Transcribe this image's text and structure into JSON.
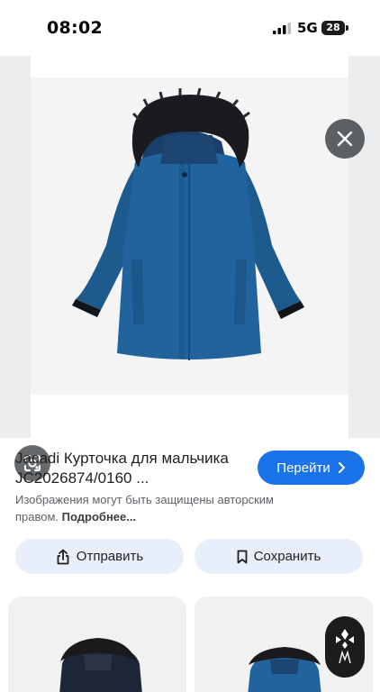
{
  "status_bar": {
    "time": "08:02",
    "network": "5G",
    "battery": "28"
  },
  "viewer": {
    "close_icon": "close-icon",
    "lens_icon": "google-lens-icon"
  },
  "result": {
    "title": "Jacadi Курточка для мальчика JC2026874/0160 ...",
    "visit_label": "Перейти",
    "visit_icon": "chevron-right-icon",
    "copyright_text": "Изображения могут быть защищены авторским правом.",
    "more_link": "Подробнее..."
  },
  "actions": {
    "share_label": "Отправить",
    "share_icon": "share-icon",
    "save_label": "Сохранить",
    "save_icon": "bookmark-icon"
  },
  "colors": {
    "accent": "#1a73e8",
    "action_bg": "#e8eefa",
    "jacket_blue": "#1f5f95",
    "fur": "#1b1b1f"
  }
}
